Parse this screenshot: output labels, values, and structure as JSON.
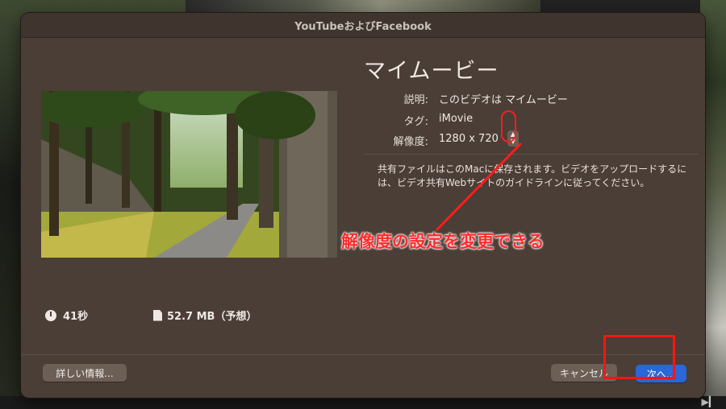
{
  "dialog": {
    "title": "YouTubeおよびFacebook",
    "movie_title": "マイムービー",
    "fields": [
      {
        "label": "説明:",
        "value": "このビデオは マイムービー"
      },
      {
        "label": "タグ:",
        "value": "iMovie"
      },
      {
        "label": "解像度:",
        "value": "1280 x 720"
      }
    ],
    "description": "共有ファイルはこのMacに保存されます。ビデオをアップロードするには、ビデオ共有Webサイトのガイドラインに従ってください。",
    "duration": "41秒",
    "file_size": "52.7 MB（予想）",
    "buttons": {
      "details": "詳しい情報...",
      "cancel": "キャンセル",
      "next": "次へ..."
    }
  },
  "annotation": {
    "text": "解像度の設定を変更できる",
    "color": "#ff1c1c"
  },
  "colors": {
    "dialog_bg": "#4a3e36",
    "primary_button": "#2a67d8"
  },
  "icons": {
    "duration": "clock-icon",
    "file_size": "document-icon",
    "resolution_control": "up-down-stepper-icon"
  }
}
